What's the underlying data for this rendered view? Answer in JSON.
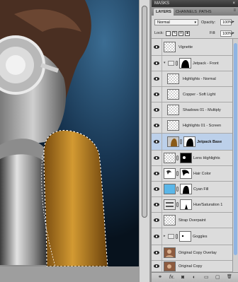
{
  "dock": {
    "title": "MASKS",
    "close": "×"
  },
  "tabs": [
    {
      "label": "LAYERS",
      "active": true
    },
    {
      "label": "CHANNELS",
      "active": false
    },
    {
      "label": "PATHS",
      "active": false
    }
  ],
  "tab_menu": "≡",
  "blend": {
    "mode": "Normal",
    "opacity_label": "Opacity:",
    "opacity_value": "100%"
  },
  "lock": {
    "label": "Lock:",
    "fill_label": "Fill:",
    "fill_value": "100%"
  },
  "layers": [
    {
      "name": "Vignette",
      "visible": true,
      "selected": false,
      "type": "pixel",
      "indent": 0
    },
    {
      "name": "Jetpack - Front",
      "visible": true,
      "selected": false,
      "type": "group",
      "indent": 0,
      "expanded": true
    },
    {
      "name": "Highlights - Normal",
      "visible": true,
      "selected": false,
      "type": "pixel",
      "indent": 1
    },
    {
      "name": "Copper - Soft Light",
      "visible": true,
      "selected": false,
      "type": "pixel",
      "indent": 1
    },
    {
      "name": "Shadows 01 - Multiply",
      "visible": true,
      "selected": false,
      "type": "pixel",
      "indent": 1
    },
    {
      "name": "Highlights 01 - Screen",
      "visible": true,
      "selected": false,
      "type": "pixel",
      "indent": 1
    },
    {
      "name": "Jetpack Base",
      "visible": true,
      "selected": true,
      "type": "masked",
      "indent": 1
    },
    {
      "name": "Lens Highlights",
      "visible": true,
      "selected": false,
      "type": "masked",
      "indent": 0
    },
    {
      "name": "Hair Color",
      "visible": true,
      "selected": false,
      "type": "adjust",
      "indent": 0
    },
    {
      "name": "Cyan Fill",
      "visible": true,
      "selected": false,
      "type": "fill",
      "indent": 0
    },
    {
      "name": "Hue/Saturation 1",
      "visible": true,
      "selected": false,
      "type": "huesat",
      "indent": 0
    },
    {
      "name": "Strap Overpaint",
      "visible": true,
      "selected": false,
      "type": "pixel",
      "indent": 0
    },
    {
      "name": "Goggles",
      "visible": true,
      "selected": false,
      "type": "group",
      "indent": 0,
      "expanded": false
    },
    {
      "name": "Original Copy Overlay",
      "visible": true,
      "selected": false,
      "type": "photo",
      "indent": 0
    },
    {
      "name": "Original Copy",
      "visible": true,
      "selected": false,
      "type": "photo",
      "indent": 0
    }
  ],
  "bottom_icons": [
    "link-icon",
    "fx-icon",
    "mask-icon",
    "adjustment-icon",
    "folder-icon",
    "new-layer-icon",
    "trash-icon"
  ],
  "bottom_glyphs": [
    "⚭",
    "fx.",
    "◙",
    "◐",
    "▭",
    "▢",
    "🗑"
  ],
  "colors": {
    "selected": "#bcd0ea",
    "cyan_fill": "#5ab6e8",
    "jetpack": "#c58a23"
  }
}
